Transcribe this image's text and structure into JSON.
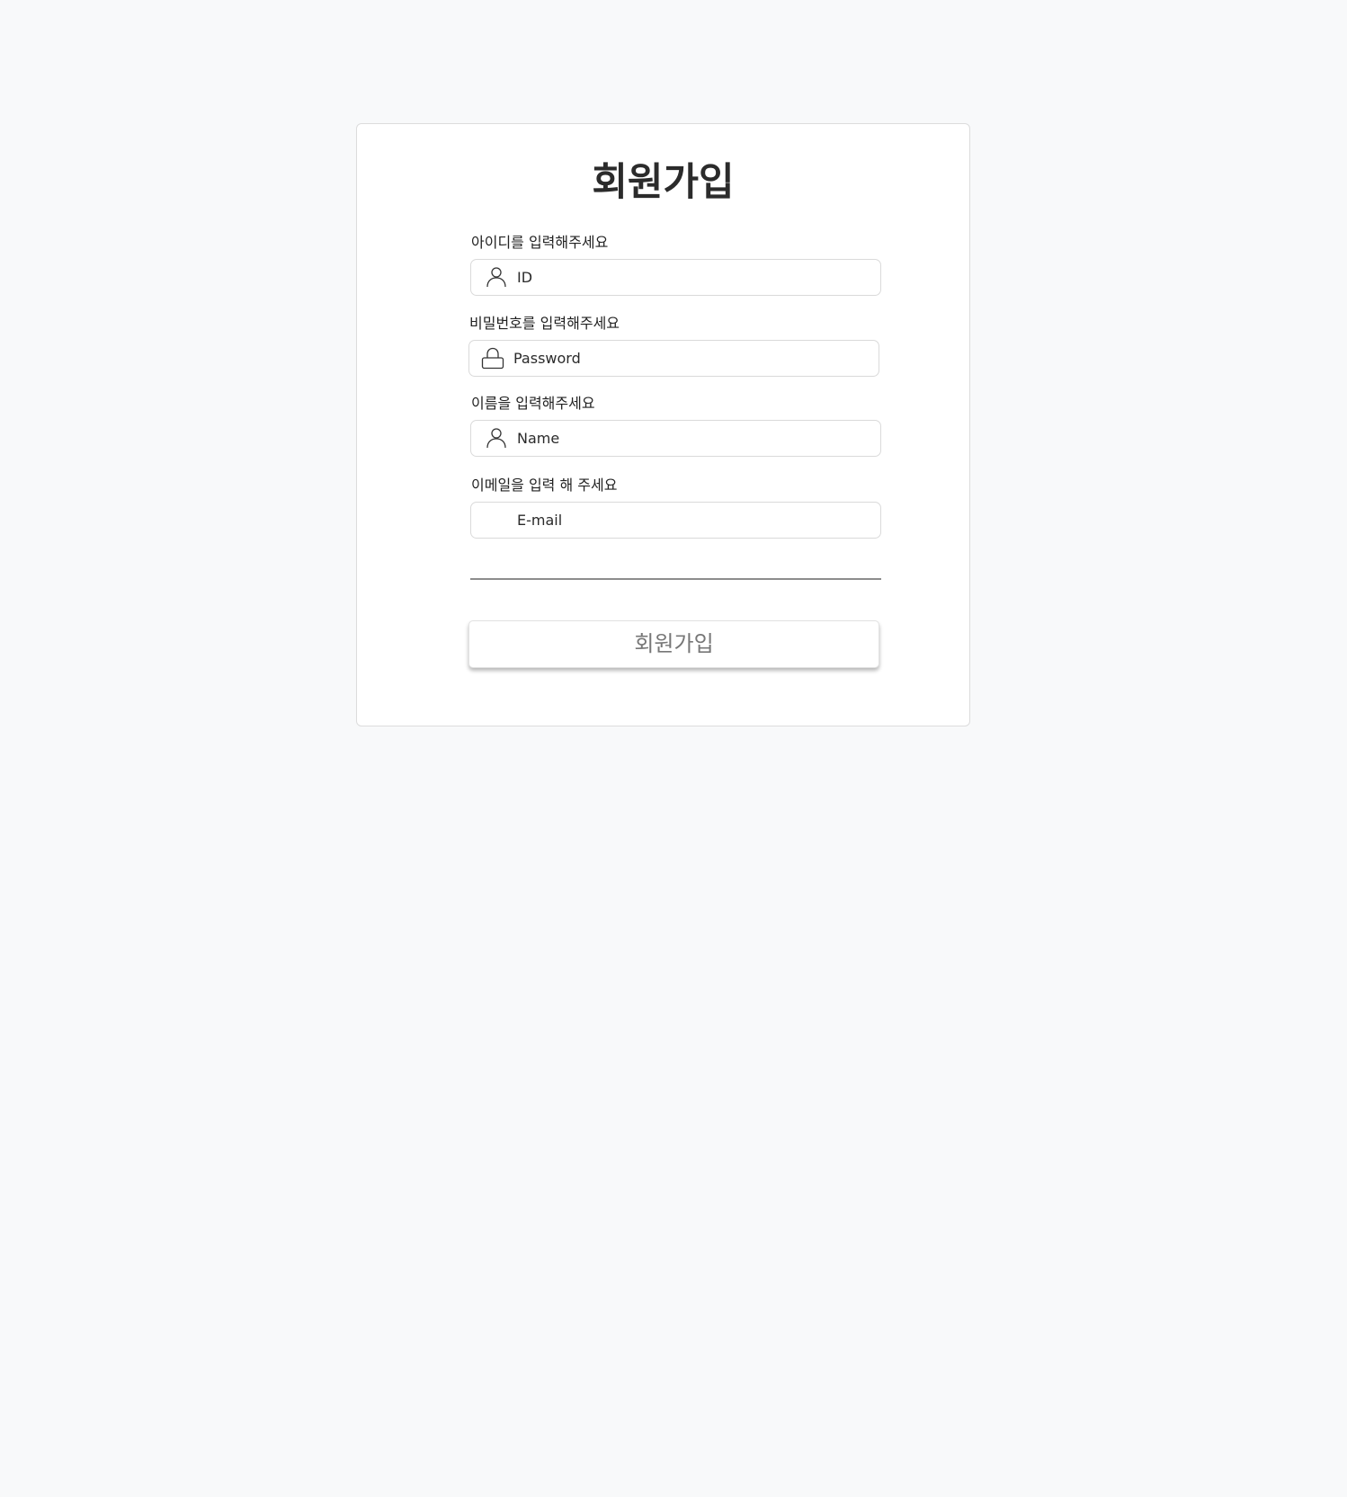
{
  "form": {
    "title": "회원가입",
    "fields": [
      {
        "label": "아이디를 입력해주세요",
        "placeholder": "ID",
        "value": "",
        "icon": "user-icon"
      },
      {
        "label": "비밀번호를 입력해주세요",
        "placeholder": "Password",
        "value": "",
        "icon": "lock-icon"
      },
      {
        "label": "이름을 입력해주세요",
        "placeholder": "Name",
        "value": "",
        "icon": "user-icon"
      },
      {
        "label": "이메일을 입력 해 주세요",
        "placeholder": "E-mail",
        "value": "",
        "icon": ""
      }
    ],
    "submit_label": "회원가입"
  },
  "colors": {
    "page_background": "#f8f9fa",
    "card_background": "#ffffff",
    "border": "#dadada",
    "button_text": "#777777"
  }
}
